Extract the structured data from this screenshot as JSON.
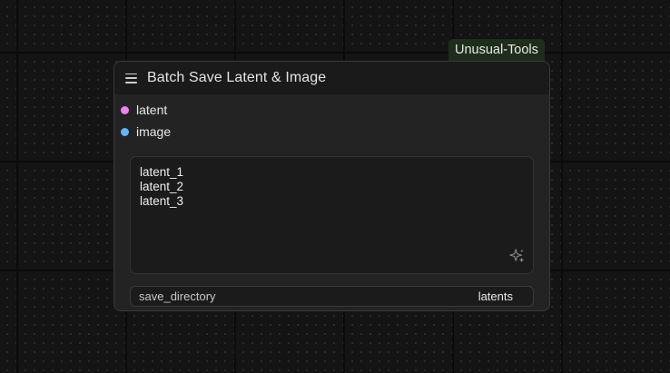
{
  "badge": {
    "label": "Unusual-Tools"
  },
  "node": {
    "title": "Batch Save Latent & Image",
    "inputs": [
      {
        "label": "latent",
        "color": "#ee82ee"
      },
      {
        "label": "image",
        "color": "#64b5f6"
      }
    ],
    "text_widget": {
      "lines": [
        "latent_1",
        "latent_2",
        "latent_3"
      ],
      "icon": "sparkle-icon"
    },
    "combo_widget": {
      "name": "save_directory",
      "value": "latents"
    }
  },
  "icons": {
    "menu": "menu-icon",
    "sparkle": "sparkle-icon"
  }
}
